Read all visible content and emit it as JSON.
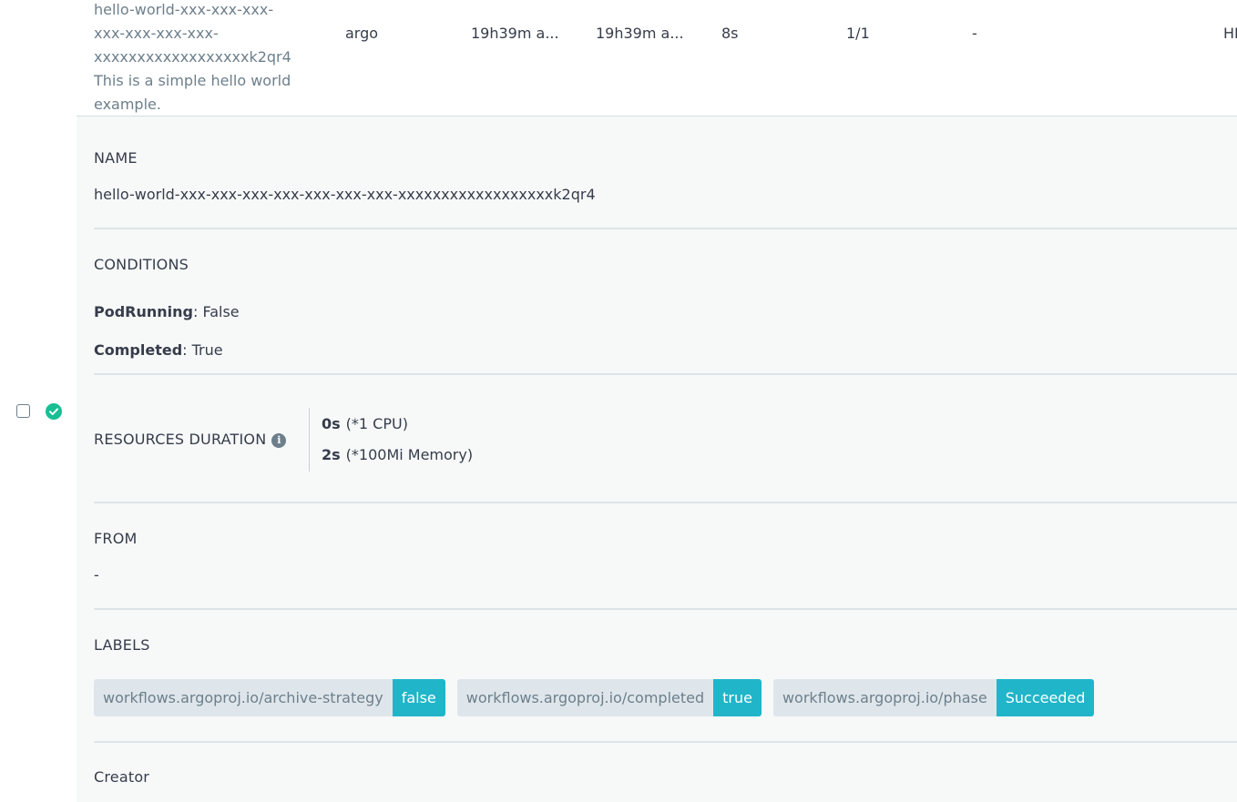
{
  "row": {
    "name_lines": [
      "hello-world-xxx-xxx-xxx-",
      "xxx-xxx-xxx-xxx-",
      "xxxxxxxxxxxxxxxxxxk2qr4"
    ],
    "description": [
      "This is a simple hello world",
      "example."
    ],
    "namespace": "argo",
    "started": "19h39m a...",
    "finished": "19h39m a...",
    "duration": "8s",
    "progress": "1/1",
    "message": "-",
    "extra": "HI"
  },
  "details": {
    "name_title": "NAME",
    "name_value": "hello-world-xxx-xxx-xxx-xxx-xxx-xxx-xxx-xxxxxxxxxxxxxxxxxxk2qr4",
    "conditions_title": "CONDITIONS",
    "conditions": [
      {
        "key": "PodRunning",
        "value": ": False"
      },
      {
        "key": "Completed",
        "value": ": True"
      }
    ],
    "resources_title": "RESOURCES DURATION",
    "resources": [
      {
        "amount": "0s",
        "unit": "(*1 CPU)"
      },
      {
        "amount": "2s",
        "unit": "(*100Mi Memory)"
      }
    ],
    "from_title": "FROM",
    "from_value": "-",
    "labels_title": "LABELS",
    "labels": [
      {
        "key": "workflows.argoproj.io/archive-strategy",
        "value": "false"
      },
      {
        "key": "workflows.argoproj.io/completed",
        "value": "true"
      },
      {
        "key": "workflows.argoproj.io/phase",
        "value": "Succeeded"
      }
    ],
    "creator_title": "Creator"
  },
  "icons": {
    "checkbox": "checkbox-icon",
    "status": "check-circle-icon",
    "info": "info-icon"
  },
  "colors": {
    "status_success": "#18be94",
    "label_value_bg": "#20b5c9",
    "label_key_bg": "#dee6eb",
    "panel_bg": "#f7f9f9"
  }
}
